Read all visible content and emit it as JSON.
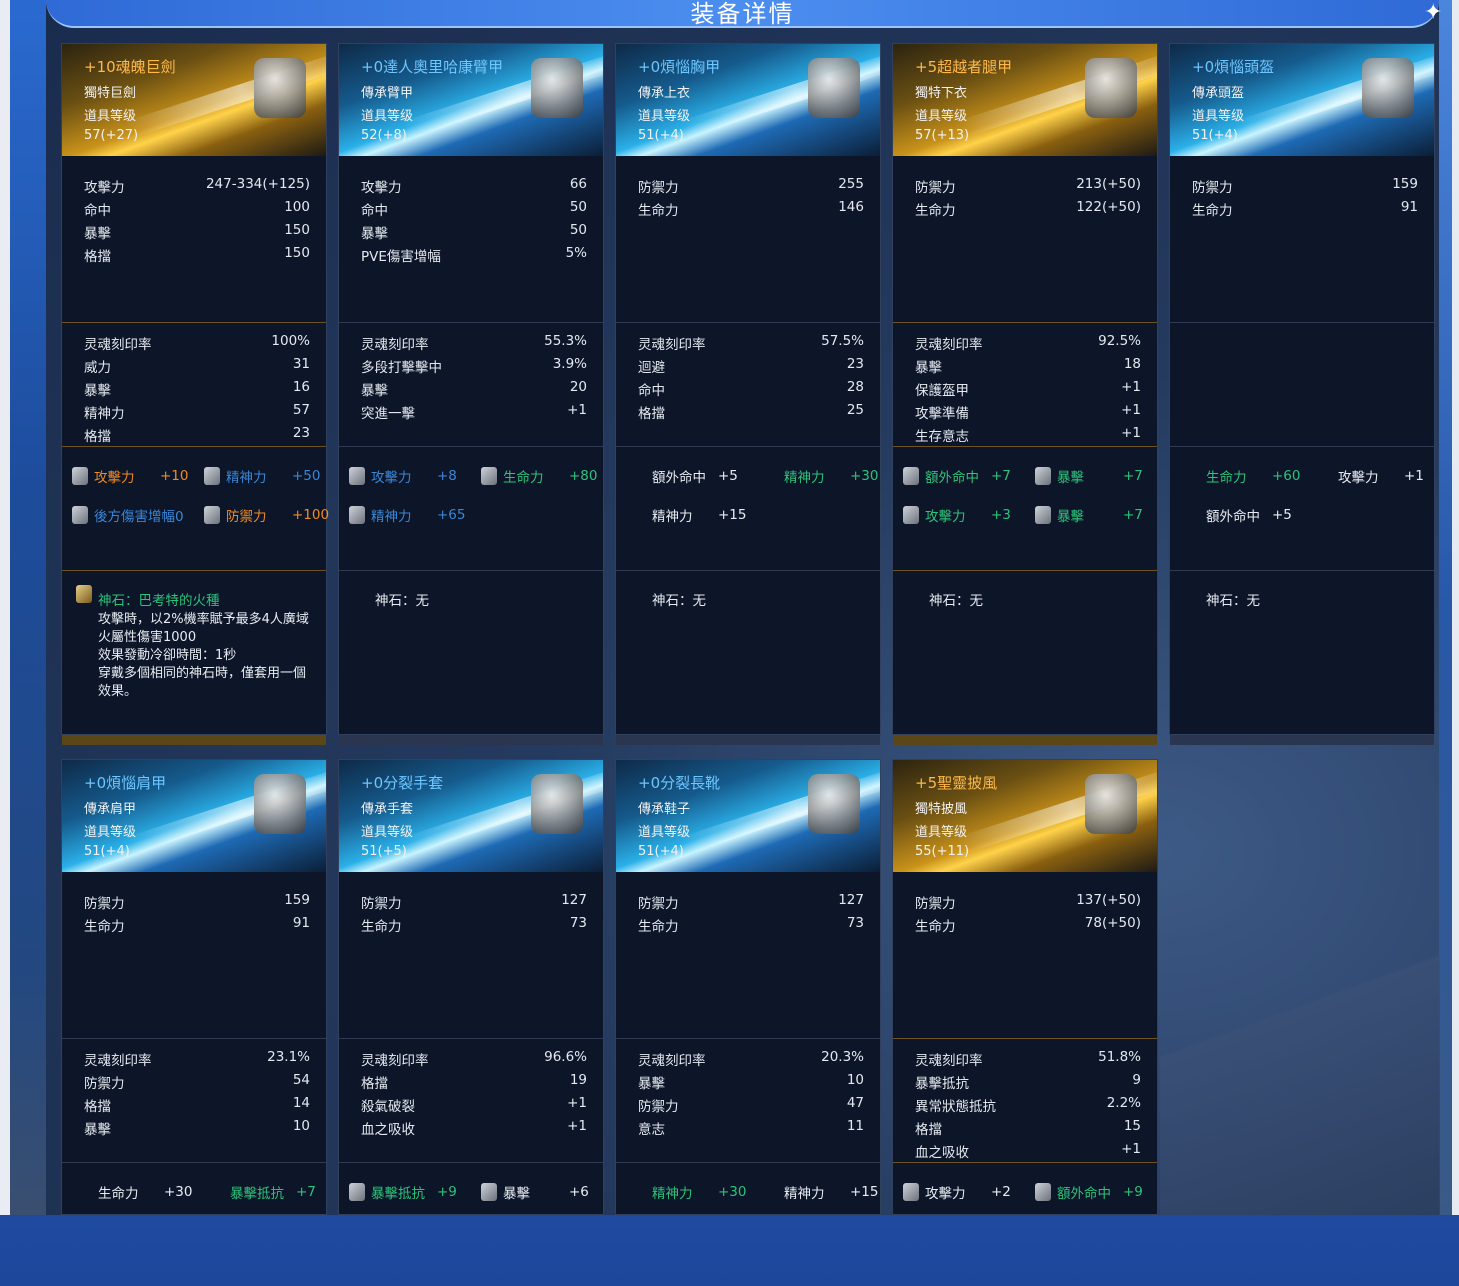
{
  "page": {
    "title": "装备详情"
  },
  "cards": [
    {
      "name": "+10魂魄巨劍",
      "type": "獨特巨劍",
      "level_label": "道具等级",
      "level": "57(+27)",
      "tier": "gold",
      "stats": [
        [
          "攻擊力",
          "247-334(+125)"
        ],
        [
          "命中",
          "100"
        ],
        [
          "暴擊",
          "150"
        ],
        [
          "格擋",
          "150"
        ]
      ],
      "soul": [
        [
          "灵魂刻印率",
          "100%"
        ],
        [
          "威力",
          "31"
        ],
        [
          "暴擊",
          "16"
        ],
        [
          "精神力",
          "57"
        ],
        [
          "格擋",
          "23"
        ]
      ],
      "ench": [
        {
          "label": "攻擊力",
          "value": "+10",
          "color": "orange",
          "icon": true
        },
        {
          "label": "精神力",
          "value": "+50",
          "color": "blue",
          "icon": true
        },
        {
          "label": "後方傷害增幅0",
          "value": "",
          "color": "blue",
          "icon": true
        },
        {
          "label": "防禦力",
          "value": "+100",
          "color": "orange",
          "icon": true
        }
      ],
      "gem": {
        "title": "神石：巴考特的火種",
        "text": "攻擊時，以2%機率賦予最多4人廣域火屬性傷害1000\n效果發動冷卻時間：1秒\n穿戴多個相同的神石時，僅套用一個效果。"
      }
    },
    {
      "name": "+0達人奧里哈康臂甲",
      "type": "傳承臂甲",
      "level_label": "道具等级",
      "level": "52(+8)",
      "tier": "blue",
      "stats": [
        [
          "攻擊力",
          "66"
        ],
        [
          "命中",
          "50"
        ],
        [
          "暴擊",
          "50"
        ],
        [
          "PVE傷害增幅",
          "5%"
        ]
      ],
      "soul": [
        [
          "灵魂刻印率",
          "55.3%"
        ],
        [
          "多段打擊擊中",
          "3.9%"
        ],
        [
          "暴擊",
          "20"
        ],
        [
          "突進一擊",
          "+1"
        ]
      ],
      "ench": [
        {
          "label": "攻擊力",
          "value": "+8",
          "color": "blue",
          "icon": true
        },
        {
          "label": "生命力",
          "value": "+80",
          "color": "green",
          "icon": true
        },
        {
          "label": "精神力",
          "value": "+65",
          "color": "blue",
          "icon": true
        }
      ],
      "gem": {
        "title": "神石：无",
        "text": ""
      }
    },
    {
      "name": "+0煩惱胸甲",
      "type": "傳承上衣",
      "level_label": "道具等级",
      "level": "51(+4)",
      "tier": "blue",
      "stats": [
        [
          "防禦力",
          "255"
        ],
        [
          "生命力",
          "146"
        ]
      ],
      "soul": [
        [
          "灵魂刻印率",
          "57.5%"
        ],
        [
          "迴避",
          "23"
        ],
        [
          "命中",
          "28"
        ],
        [
          "格擋",
          "25"
        ]
      ],
      "ench": [
        {
          "label": "額外命中",
          "value": "+5",
          "color": "white",
          "icon": false
        },
        {
          "label": "精神力",
          "value": "+30",
          "color": "green",
          "icon": false
        },
        {
          "label": "精神力",
          "value": "+15",
          "color": "white",
          "icon": false
        }
      ],
      "gem": {
        "title": "神石：无",
        "text": ""
      }
    },
    {
      "name": "+5超越者腿甲",
      "type": "獨特下衣",
      "level_label": "道具等级",
      "level": "57(+13)",
      "tier": "gold",
      "stats": [
        [
          "防禦力",
          "213(+50)"
        ],
        [
          "生命力",
          "122(+50)"
        ]
      ],
      "soul": [
        [
          "灵魂刻印率",
          "92.5%"
        ],
        [
          "暴擊",
          "18"
        ],
        [
          "保護盔甲",
          "+1"
        ],
        [
          "攻擊準備",
          "+1"
        ],
        [
          "生存意志",
          "+1"
        ]
      ],
      "ench": [
        {
          "label": "額外命中",
          "value": "+7",
          "color": "green",
          "icon": true
        },
        {
          "label": "暴擊",
          "value": "+7",
          "color": "green",
          "icon": true
        },
        {
          "label": "攻擊力",
          "value": "+3",
          "color": "green",
          "icon": true
        },
        {
          "label": "暴擊",
          "value": "+7",
          "color": "green",
          "icon": true
        }
      ],
      "gem": {
        "title": "神石：无",
        "text": ""
      }
    },
    {
      "name": "+0煩惱頭盔",
      "type": "傳承頭盔",
      "level_label": "道具等级",
      "level": "51(+4)",
      "tier": "blue",
      "stats": [
        [
          "防禦力",
          "159"
        ],
        [
          "生命力",
          "91"
        ]
      ],
      "soul": [],
      "ench": [
        {
          "label": "生命力",
          "value": "+60",
          "color": "green",
          "icon": false
        },
        {
          "label": "攻擊力",
          "value": "+1",
          "color": "white",
          "icon": false
        },
        {
          "label": "額外命中",
          "value": "+5",
          "color": "white",
          "icon": false
        }
      ],
      "gem": {
        "title": "神石：无",
        "text": ""
      }
    },
    {
      "name": "+0煩惱肩甲",
      "type": "傳承肩甲",
      "level_label": "道具等级",
      "level": "51(+4)",
      "tier": "blue",
      "stats": [
        [
          "防禦力",
          "159"
        ],
        [
          "生命力",
          "91"
        ]
      ],
      "soul": [
        [
          "灵魂刻印率",
          "23.1%"
        ],
        [
          "防禦力",
          "54"
        ],
        [
          "格擋",
          "14"
        ],
        [
          "暴擊",
          "10"
        ]
      ],
      "ench": [
        {
          "label": "生命力",
          "value": "+30",
          "color": "white",
          "icon": false
        },
        {
          "label": "暴擊抵抗",
          "value": "+7",
          "color": "green",
          "icon": false
        }
      ]
    },
    {
      "name": "+0分裂手套",
      "type": "傳承手套",
      "level_label": "道具等级",
      "level": "51(+5)",
      "tier": "blue",
      "stats": [
        [
          "防禦力",
          "127"
        ],
        [
          "生命力",
          "73"
        ]
      ],
      "soul": [
        [
          "灵魂刻印率",
          "96.6%"
        ],
        [
          "格擋",
          "19"
        ],
        [
          "殺氣破裂",
          "+1"
        ],
        [
          "血之吸收",
          "+1"
        ]
      ],
      "ench": [
        {
          "label": "暴擊抵抗",
          "value": "+9",
          "color": "green",
          "icon": true
        },
        {
          "label": "暴擊",
          "value": "+6",
          "color": "white",
          "icon": true
        }
      ]
    },
    {
      "name": "+0分裂長靴",
      "type": "傳承鞋子",
      "level_label": "道具等级",
      "level": "51(+4)",
      "tier": "blue",
      "stats": [
        [
          "防禦力",
          "127"
        ],
        [
          "生命力",
          "73"
        ]
      ],
      "soul": [
        [
          "灵魂刻印率",
          "20.3%"
        ],
        [
          "暴擊",
          "10"
        ],
        [
          "防禦力",
          "47"
        ],
        [
          "意志",
          "11"
        ]
      ],
      "ench": [
        {
          "label": "精神力",
          "value": "+30",
          "color": "green",
          "icon": false
        },
        {
          "label": "精神力",
          "value": "+15",
          "color": "white",
          "icon": false
        }
      ]
    },
    {
      "name": "+5聖靈披風",
      "type": "獨特披風",
      "level_label": "道具等级",
      "level": "55(+11)",
      "tier": "gold",
      "stats": [
        [
          "防禦力",
          "137(+50)"
        ],
        [
          "生命力",
          "78(+50)"
        ]
      ],
      "soul": [
        [
          "灵魂刻印率",
          "51.8%"
        ],
        [
          "暴擊抵抗",
          "9"
        ],
        [
          "異常狀態抵抗",
          "2.2%"
        ],
        [
          "格擋",
          "15"
        ],
        [
          "血之吸收",
          "+1"
        ]
      ],
      "ench": [
        {
          "label": "攻擊力",
          "value": "+2",
          "color": "white",
          "icon": true
        },
        {
          "label": "額外命中",
          "value": "+9",
          "color": "green",
          "icon": true
        }
      ]
    }
  ]
}
